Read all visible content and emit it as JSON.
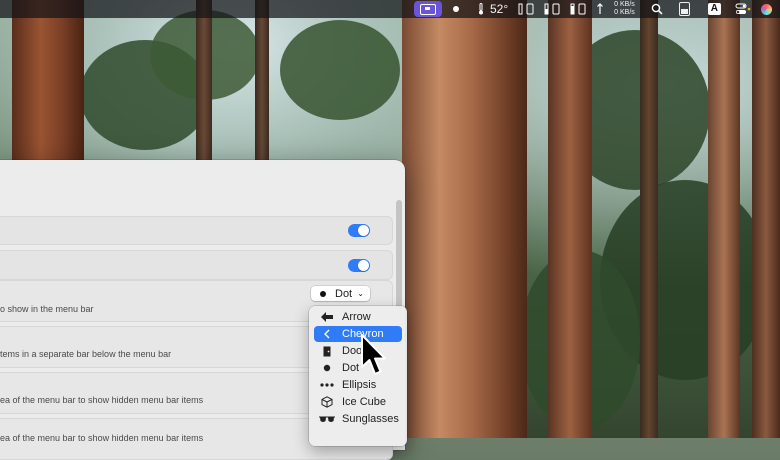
{
  "menubar": {
    "temperature": "52°",
    "net_up": "0 KB/s",
    "net_down": "0 KB/s",
    "keyboard_label": "A",
    "icons": [
      "menu-bar-manager-icon",
      "dot-icon",
      "thermometer-icon",
      "cpu-icon",
      "memory-icon",
      "disk-icon",
      "network-arrows-icon",
      "spotlight-icon",
      "battery-icon",
      "input-source-icon",
      "control-center-icon",
      "siri-icon"
    ]
  },
  "settings": {
    "rows": [
      {
        "text": ""
      },
      {
        "text": ""
      },
      {
        "text": "o show in the menu bar"
      },
      {
        "text": "tems in a separate bar below the menu bar"
      },
      {
        "text": "ea of the menu bar to show hidden menu bar items"
      },
      {
        "text": "ea of the menu bar to show hidden menu bar items"
      }
    ],
    "popup_value": "Dot"
  },
  "menu": {
    "items": [
      {
        "label": "Arrow",
        "icon": "arrow-left-icon"
      },
      {
        "label": "Chevron",
        "icon": "chevron-left-icon",
        "selected": true
      },
      {
        "label": "Door",
        "icon": "door-icon"
      },
      {
        "label": "Dot",
        "icon": "dot-icon"
      },
      {
        "label": "Ellipsis",
        "icon": "ellipsis-icon"
      },
      {
        "label": "Ice Cube",
        "icon": "cube-icon"
      },
      {
        "label": "Sunglasses",
        "icon": "sunglasses-icon"
      }
    ]
  }
}
